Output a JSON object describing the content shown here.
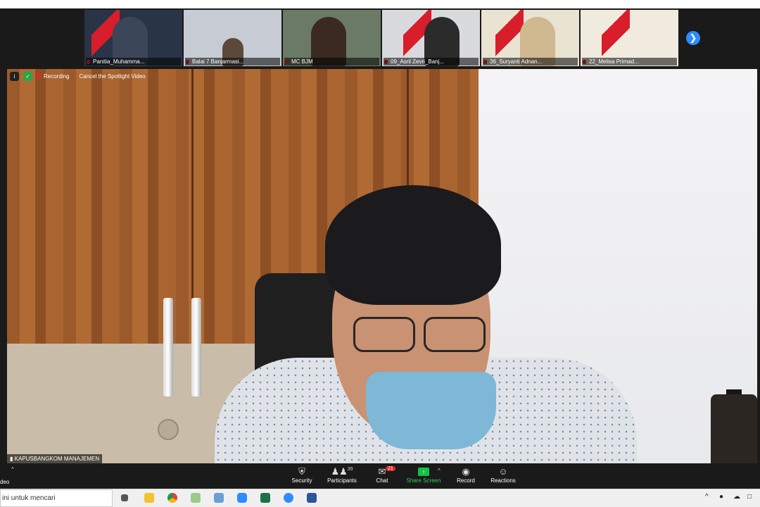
{
  "thumbnails": [
    {
      "label": "Panitia_Muhamma...",
      "bg": "#2a3447",
      "person": "#3b4658"
    },
    {
      "label": "Balai 7 Banjarmasi...",
      "bg": "#c7cbd3",
      "person": "#5b4a3a"
    },
    {
      "label": "MC BJM",
      "bg": "#6b7a64",
      "person": "#3a2a22"
    },
    {
      "label": "09_Asril Zevri_Banj...",
      "bg": "#d9dadd",
      "person": "#2b2b2b"
    },
    {
      "label": "36_Suryanti Adnan...",
      "bg": "#e9e3d2",
      "person": "#d0b890"
    },
    {
      "label": "22_Melisa Primad...",
      "bg": "#f1eadf",
      "person": "#e7e2da"
    }
  ],
  "overlay": {
    "info_icon": "i",
    "recording_label": "Recording",
    "cancel_spotlight": "Cancel the Spotlight Video"
  },
  "speaker_name": "KAPUSBANGKOM MANAJEMEN",
  "toolbar": {
    "video_label": "deo",
    "security_label": "Security",
    "participants_label": "Participants",
    "participants_count": "39",
    "chat_label": "Chat",
    "chat_badge": "21",
    "share_label": "Share Screen",
    "record_label": "Record",
    "reactions_label": "Reactions"
  },
  "taskbar": {
    "search_text": "ini untuk mencari",
    "apps": [
      "task-view",
      "file-explorer",
      "chrome",
      "sticky",
      "notepad",
      "zoom",
      "excel",
      "zoom-meetings",
      "word"
    ]
  },
  "colors": {
    "zoom_blue": "#2d8cff",
    "share_green": "#16c048",
    "record_red": "#e02828"
  }
}
